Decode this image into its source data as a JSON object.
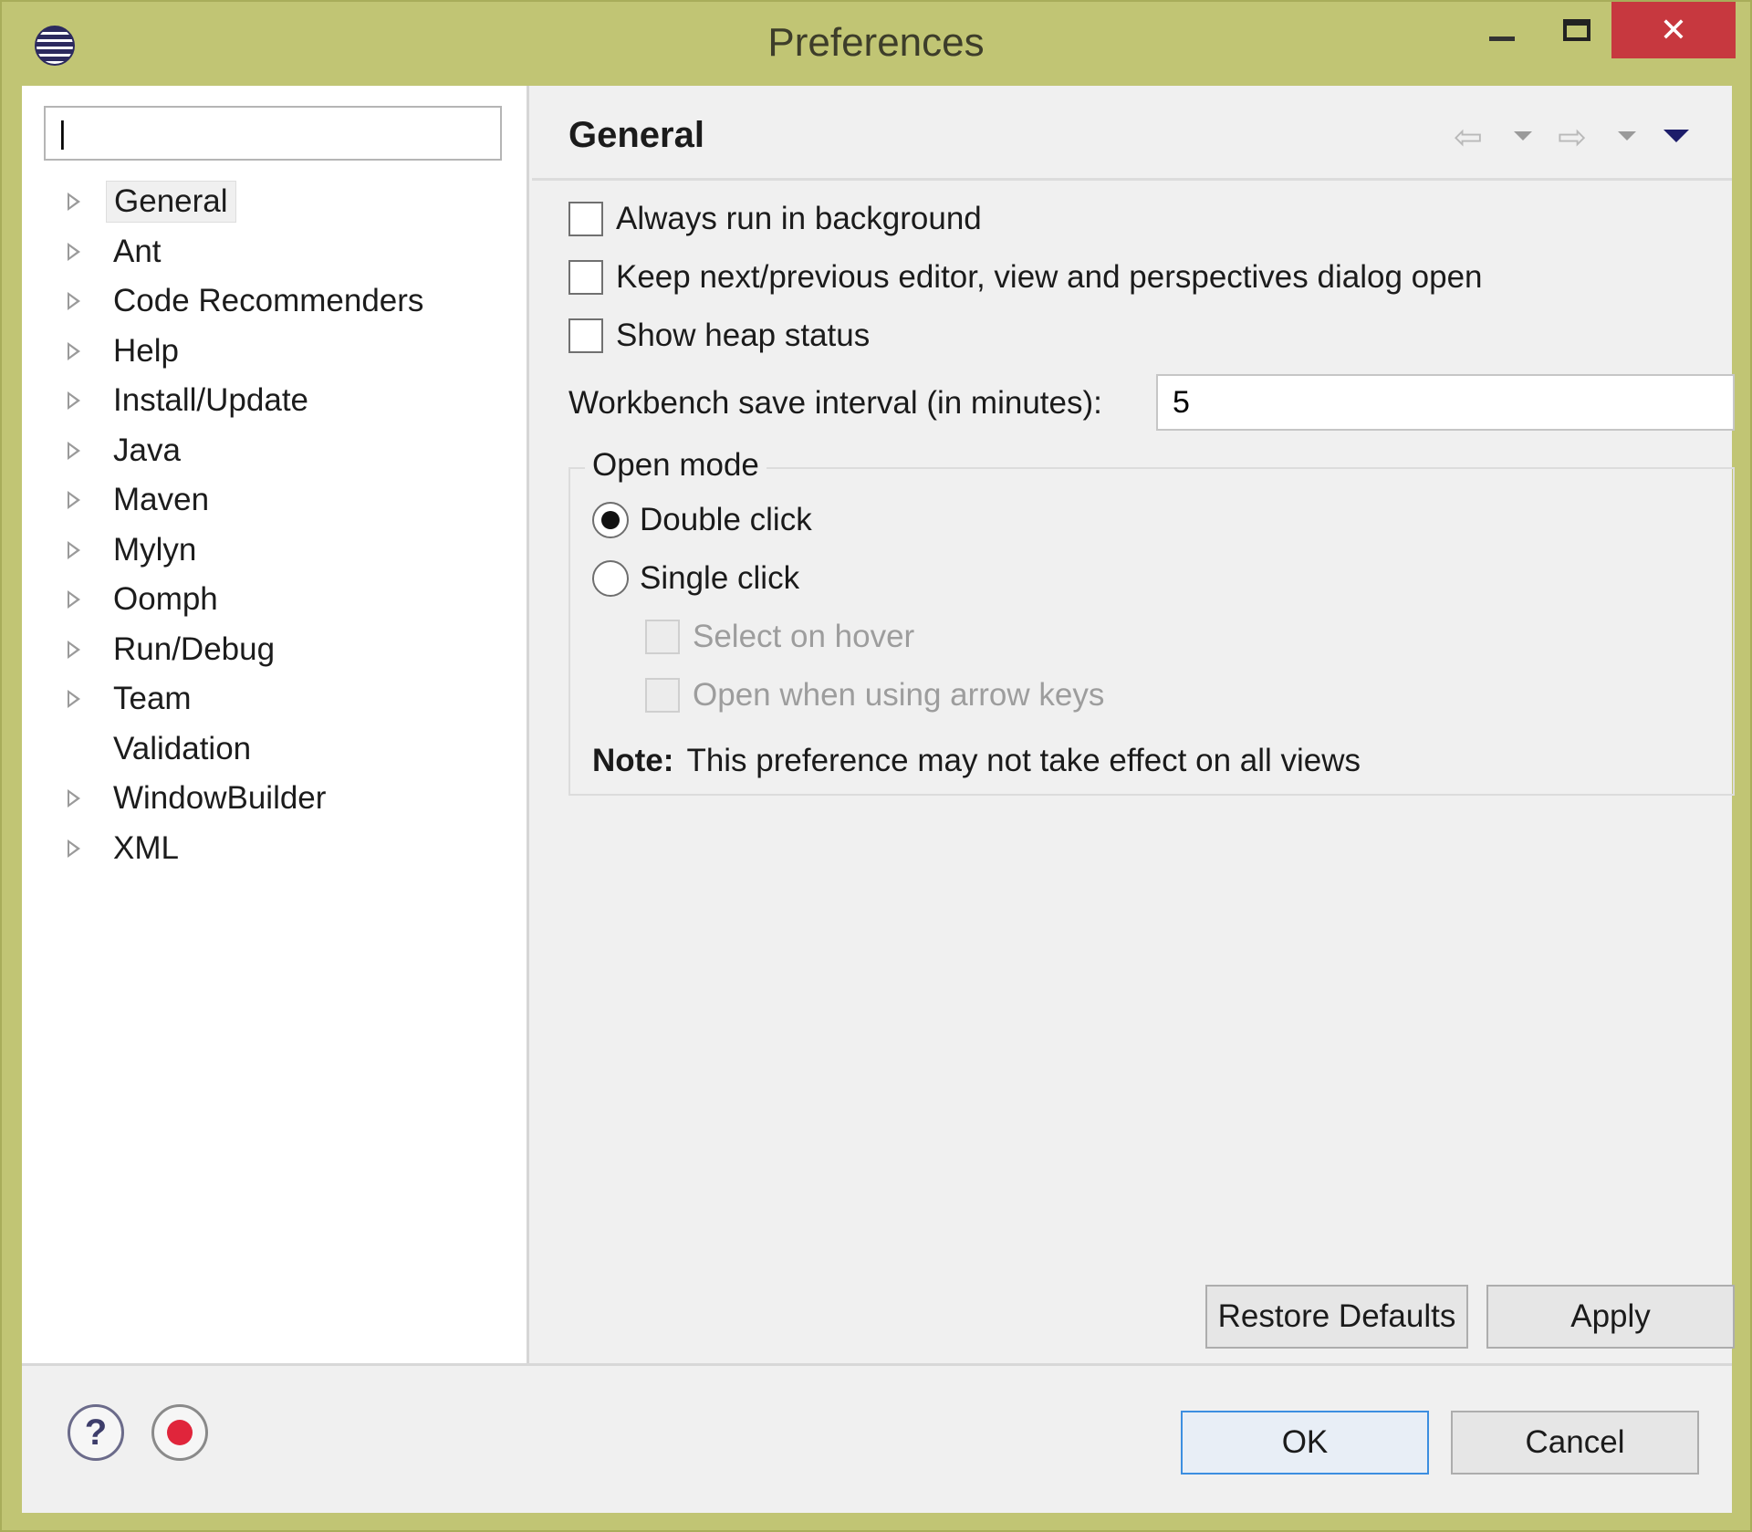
{
  "window": {
    "title": "Preferences",
    "close_glyph": "✕"
  },
  "left_pane": {
    "filter_value": "|",
    "tree": [
      {
        "label": "General",
        "expandable": true,
        "selected": true
      },
      {
        "label": "Ant",
        "expandable": true
      },
      {
        "label": "Code Recommenders",
        "expandable": true
      },
      {
        "label": "Help",
        "expandable": true
      },
      {
        "label": "Install/Update",
        "expandable": true
      },
      {
        "label": "Java",
        "expandable": true
      },
      {
        "label": "Maven",
        "expandable": true
      },
      {
        "label": "Mylyn",
        "expandable": true
      },
      {
        "label": "Oomph",
        "expandable": true
      },
      {
        "label": "Run/Debug",
        "expandable": true
      },
      {
        "label": "Team",
        "expandable": true
      },
      {
        "label": "Validation",
        "expandable": false
      },
      {
        "label": "WindowBuilder",
        "expandable": true
      },
      {
        "label": "XML",
        "expandable": true
      }
    ]
  },
  "page": {
    "title": "General",
    "nav_back": "⇦",
    "nav_forward": "⇨",
    "options": {
      "always_run_background": "Always run in background",
      "keep_dialog_open": "Keep next/previous editor, view and perspectives dialog open",
      "show_heap_status": "Show heap status"
    },
    "interval_label": "Workbench save interval (in minutes):",
    "interval_value": "5",
    "open_mode": {
      "legend": "Open mode",
      "double_click": "Double click",
      "single_click": "Single click",
      "select_on_hover": "Select on hover",
      "open_arrow_keys": "Open when using arrow keys",
      "note_label": "Note:",
      "note_text": "This preference may not take effect on all views"
    },
    "restore_defaults": "Restore Defaults",
    "apply": "Apply"
  },
  "footer": {
    "help_glyph": "?",
    "ok": "OK",
    "cancel": "Cancel"
  }
}
